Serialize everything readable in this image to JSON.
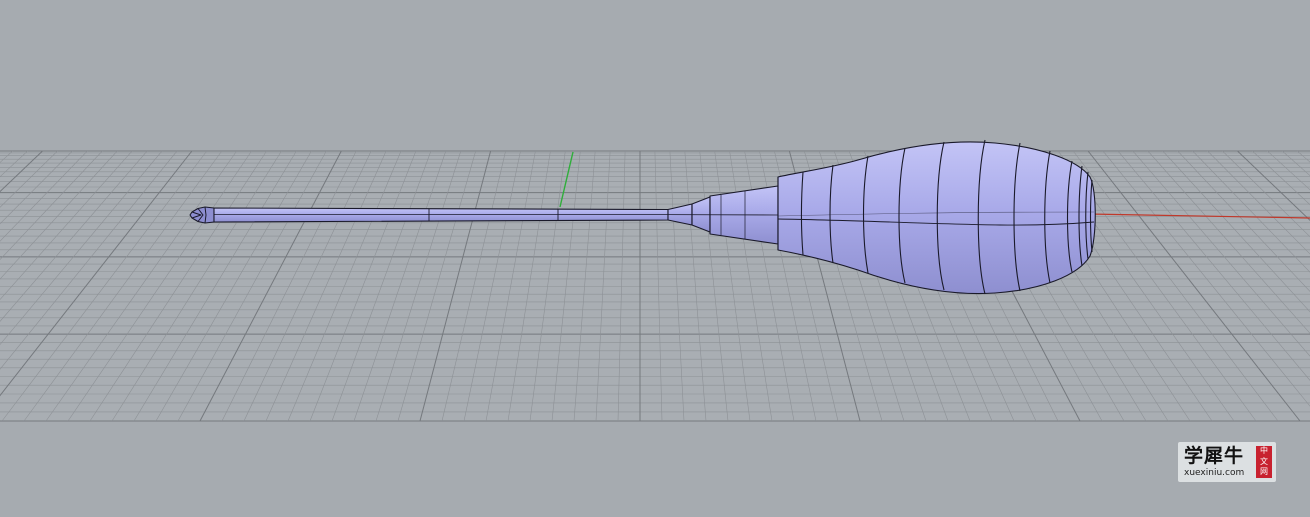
{
  "viewport": {
    "view": "perspective",
    "object": "screwdriver",
    "background_color": "#a6abb0",
    "grid_color": "#8d9196",
    "grid_major_color": "#75797e",
    "x_axis_color": "#c0392b",
    "y_axis_color": "#2fae3a",
    "shaded_color": "#a9aaea",
    "edge_color": "#1a1a2a"
  },
  "watermark": {
    "brand": "学犀牛",
    "url": "xuexiniu.com",
    "seal": [
      "中",
      "文",
      "网"
    ]
  }
}
